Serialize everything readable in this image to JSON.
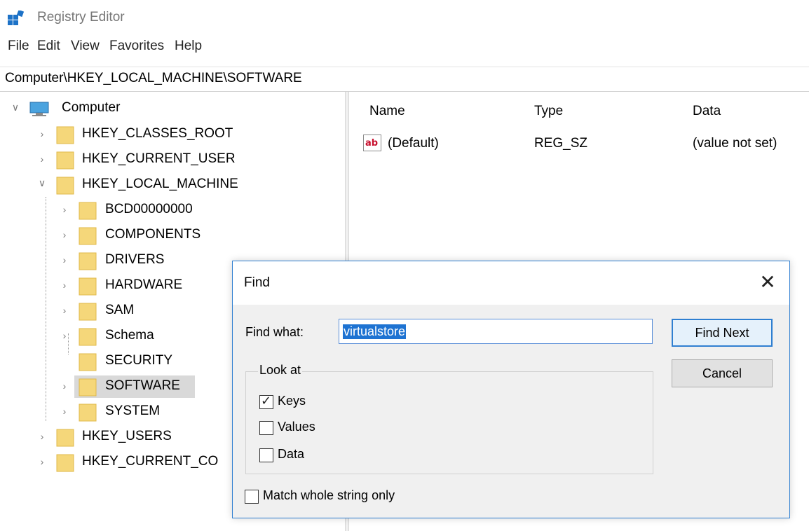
{
  "window": {
    "title": "Registry Editor"
  },
  "menu": [
    "File",
    "Edit",
    "View",
    "Favorites",
    "Help"
  ],
  "address": "Computer\\HKEY_LOCAL_MACHINE\\SOFTWARE",
  "tree": {
    "root": "Computer",
    "hives": [
      "HKEY_CLASSES_ROOT",
      "HKEY_CURRENT_USER",
      "HKEY_LOCAL_MACHINE"
    ],
    "hklm_children": [
      "BCD00000000",
      "COMPONENTS",
      "DRIVERS",
      "HARDWARE",
      "SAM",
      "Schema",
      "SECURITY",
      "SOFTWARE",
      "SYSTEM"
    ],
    "after_hives": [
      "HKEY_USERS",
      "HKEY_CURRENT_CO"
    ],
    "selected": "SOFTWARE"
  },
  "list": {
    "columns": [
      "Name",
      "Type",
      "Data"
    ],
    "rows": [
      {
        "name": "(Default)",
        "type": "REG_SZ",
        "data": "(value not set)",
        "icon": "string-value-icon"
      }
    ]
  },
  "find_dialog": {
    "title": "Find",
    "find_what_label": "Find what:",
    "find_what_value": "virtualstore",
    "find_next_label": "Find Next",
    "cancel_label": "Cancel",
    "look_at_label": "Look at",
    "options": [
      {
        "label": "Keys",
        "checked": true
      },
      {
        "label": "Values",
        "checked": false
      },
      {
        "label": "Data",
        "checked": false
      }
    ],
    "match_whole_label": "Match whole string only",
    "match_whole_checked": false
  },
  "colors": {
    "accent": "#2f7fd1",
    "selection": "#1e73d2",
    "folder": "#f5d77a"
  }
}
